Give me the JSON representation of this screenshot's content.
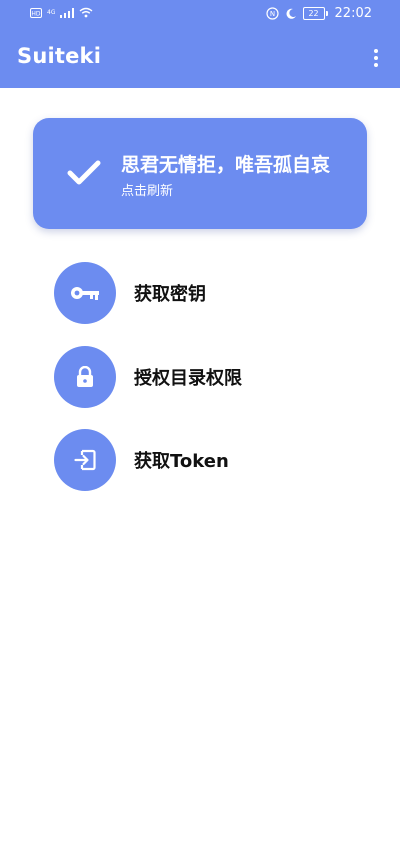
{
  "status_bar": {
    "left_icons": [
      "hd-icon",
      "signal-4g-icon",
      "signal-bars-icon",
      "wifi-icon"
    ],
    "right_icons": [
      "nfc-icon",
      "moon-icon",
      "battery-icon"
    ],
    "battery_level": "22",
    "time": "22:02"
  },
  "app_bar": {
    "title": "Suiteki",
    "menu_icon": "more-vert-icon"
  },
  "status_card": {
    "icon": "checkmark-icon",
    "title": "思君无情拒，唯吾孤自哀",
    "subtitle": "点击刷新"
  },
  "actions": [
    {
      "icon": "key-icon",
      "label": "获取密钥"
    },
    {
      "icon": "lock-icon",
      "label": "授权目录权限"
    },
    {
      "icon": "login-icon",
      "label": "获取Token"
    }
  ],
  "colors": {
    "primary": "#6c8cf0",
    "background": "#ffffff",
    "text": "#111111"
  }
}
